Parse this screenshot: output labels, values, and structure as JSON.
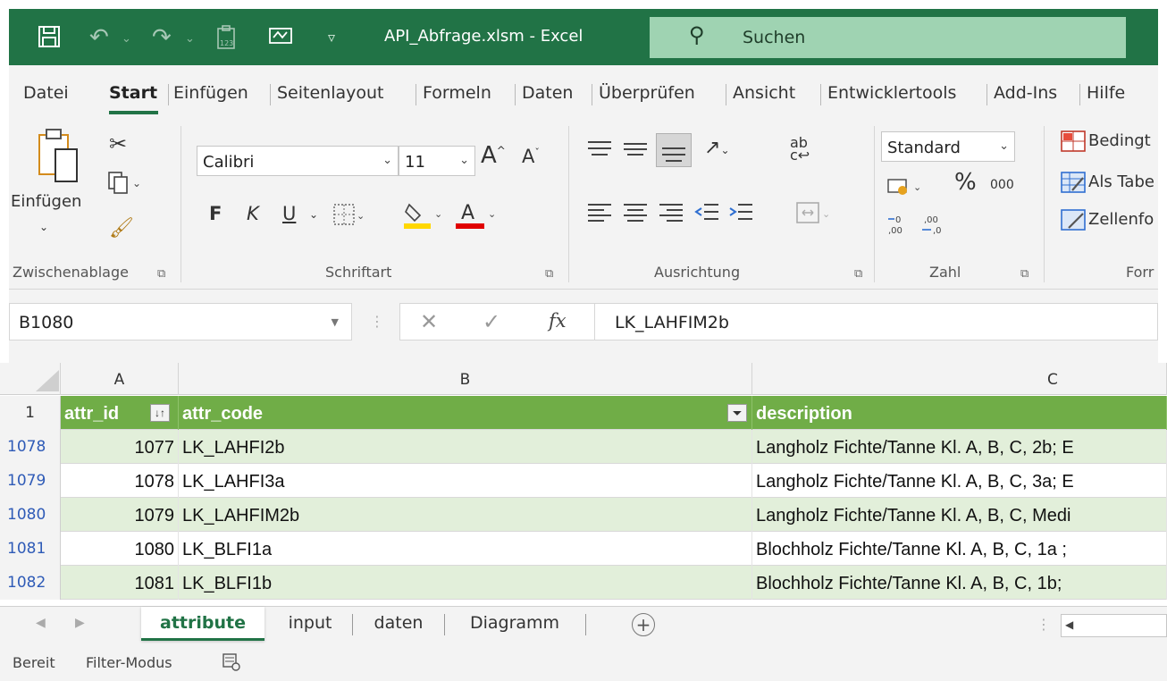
{
  "titlebar": {
    "title": "API_Abfrage.xlsm  -  Excel",
    "search_label": "Suchen"
  },
  "menu": {
    "tabs": [
      "Datei",
      "Start",
      "Einfügen",
      "Seitenlayout",
      "Formeln",
      "Daten",
      "Überprüfen",
      "Ansicht",
      "Entwicklertools",
      "Add-Ins",
      "Hilfe"
    ]
  },
  "ribbon": {
    "clipboard": {
      "paste_label": "Einfügen",
      "group_label": "Zwischenablage"
    },
    "font": {
      "family": "Calibri",
      "size": "11",
      "bold": "F",
      "italic": "K",
      "underline": "U",
      "group_label": "Schriftart",
      "fill_color": "#ffd700",
      "font_color": "#e00000"
    },
    "alignment": {
      "group_label": "Ausrichtung"
    },
    "number": {
      "format": "Standard",
      "percent": "%",
      "thousands": "000",
      "group_label": "Zahl"
    },
    "styles": {
      "conditional": "Bedingt",
      "as_table": "Als Tabe",
      "cell_styles": "Zellenfo",
      "group_label": "Forr"
    }
  },
  "formula_bar": {
    "name_box": "B1080",
    "fx": "fx",
    "value": "LK_LAHFIM2b"
  },
  "grid": {
    "columns": [
      "A",
      "B",
      "C"
    ],
    "header": {
      "row_num": "1",
      "attr_id": "attr_id",
      "attr_code": "attr_code",
      "description": "description"
    },
    "rows": [
      {
        "row_num": "1078",
        "attr_id": "1077",
        "attr_code": "LK_LAHFI2b",
        "description": "Langholz Fichte/Tanne Kl. A, B, C, 2b; E"
      },
      {
        "row_num": "1079",
        "attr_id": "1078",
        "attr_code": "LK_LAHFI3a",
        "description": "Langholz Fichte/Tanne Kl. A, B, C, 3a; E"
      },
      {
        "row_num": "1080",
        "attr_id": "1079",
        "attr_code": "LK_LAHFIM2b",
        "description": "Langholz Fichte/Tanne Kl. A, B, C, Medi"
      },
      {
        "row_num": "1081",
        "attr_id": "1080",
        "attr_code": "LK_BLFI1a",
        "description": "Blochholz Fichte/Tanne Kl. A, B, C, 1a ;"
      },
      {
        "row_num": "1082",
        "attr_id": "1081",
        "attr_code": "LK_BLFI1b",
        "description": "Blochholz Fichte/Tanne Kl. A, B, C, 1b;"
      }
    ],
    "colors": {
      "header": "#70ad47",
      "band": "#e2efda",
      "accent": "#217346"
    }
  },
  "sheets": {
    "tabs": [
      "attribute",
      "input",
      "daten",
      "Diagramm"
    ],
    "active": "attribute"
  },
  "status": {
    "ready": "Bereit",
    "filter_mode": "Filter-Modus"
  }
}
